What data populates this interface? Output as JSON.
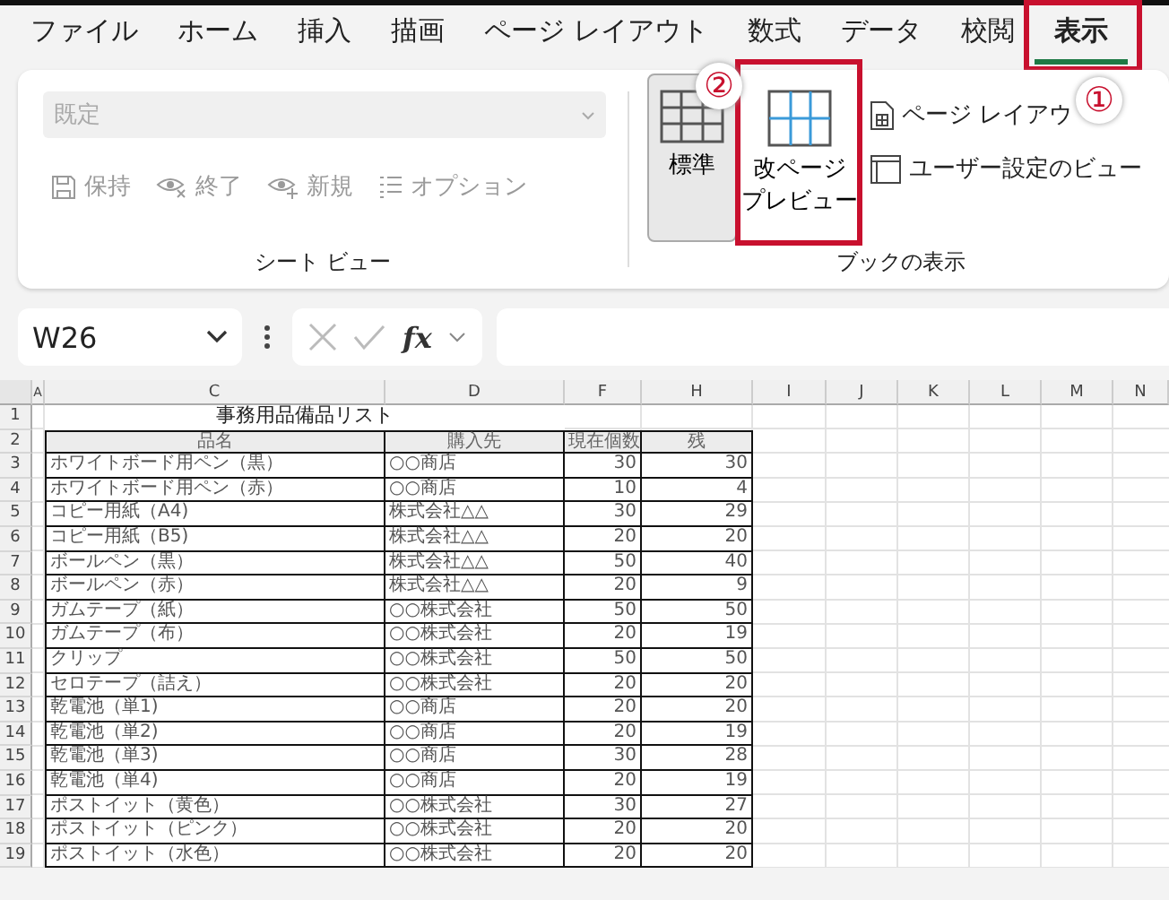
{
  "tabs": [
    {
      "label": "ファイル",
      "selected": false,
      "highlighted": false
    },
    {
      "label": "ホーム",
      "selected": false,
      "highlighted": false
    },
    {
      "label": "挿入",
      "selected": false,
      "highlighted": false
    },
    {
      "label": "描画",
      "selected": false,
      "highlighted": false
    },
    {
      "label": "ページ レイアウト",
      "selected": false,
      "highlighted": false
    },
    {
      "label": "数式",
      "selected": false,
      "highlighted": false
    },
    {
      "label": "データ",
      "selected": false,
      "highlighted": false
    },
    {
      "label": "校閲",
      "selected": false,
      "highlighted": false
    },
    {
      "label": "表示",
      "selected": true,
      "highlighted": true
    }
  ],
  "sheet_view": {
    "dropdown": {
      "value": "既定",
      "disabled": true
    },
    "buttons": [
      {
        "label": "保持",
        "kind": "save",
        "disabled": true
      },
      {
        "label": "終了",
        "kind": "exit",
        "disabled": true
      },
      {
        "label": "新規",
        "kind": "new",
        "disabled": true
      },
      {
        "label": "オプション",
        "kind": "options",
        "disabled": true
      }
    ],
    "group_label": "シート ビュー"
  },
  "workbook_views": {
    "large_buttons": [
      {
        "lines": [
          "標準"
        ],
        "kind": "normal",
        "selected": true,
        "highlighted": false
      },
      {
        "lines": [
          "改ページ",
          "プレビュー"
        ],
        "kind": "pagebreak",
        "selected": false,
        "highlighted": true
      }
    ],
    "small_buttons": [
      {
        "label": "ページ レイアウ",
        "kind": "page"
      },
      {
        "label": "ユーザー設定のビュー",
        "kind": "custom"
      }
    ],
    "group_label": "ブックの表示"
  },
  "annotations": [
    {
      "number": "②",
      "kind": "button"
    },
    {
      "number": "①",
      "kind": "tab"
    }
  ],
  "formula_bar": {
    "name_box": "W26",
    "fx": "fx"
  },
  "sheet": {
    "columns": [
      "A",
      "C",
      "D",
      "F",
      "H",
      "I",
      "J",
      "K",
      "L",
      "M",
      "N"
    ],
    "title_row": {
      "number": "1",
      "title": "事務用品備品リスト"
    },
    "header_row": {
      "number": "2",
      "cells": [
        "",
        "品名",
        "購入先",
        "現在個数",
        "残"
      ]
    },
    "rows": [
      {
        "number": "3",
        "cells": [
          "",
          "ホワイトボード用ペン（黒）",
          "○○商店",
          "30",
          "30"
        ]
      },
      {
        "number": "4",
        "cells": [
          "",
          "ホワイトボード用ペン（赤）",
          "○○商店",
          "10",
          "4"
        ]
      },
      {
        "number": "5",
        "cells": [
          "",
          "コピー用紙（A4)",
          "株式会社△△",
          "30",
          "29"
        ]
      },
      {
        "number": "6",
        "cells": [
          "",
          "コピー用紙（B5)",
          "株式会社△△",
          "20",
          "20"
        ]
      },
      {
        "number": "7",
        "cells": [
          "",
          "ボールペン（黒）",
          "株式会社△△",
          "50",
          "40"
        ]
      },
      {
        "number": "8",
        "cells": [
          "",
          "ボールペン（赤）",
          "株式会社△△",
          "20",
          "9"
        ]
      },
      {
        "number": "9",
        "cells": [
          "",
          "ガムテープ（紙）",
          "○○株式会社",
          "50",
          "50"
        ]
      },
      {
        "number": "10",
        "cells": [
          "",
          "ガムテープ（布）",
          "○○株式会社",
          "20",
          "19"
        ]
      },
      {
        "number": "11",
        "cells": [
          "",
          "クリップ",
          "○○株式会社",
          "50",
          "50"
        ]
      },
      {
        "number": "12",
        "cells": [
          "",
          "セロテープ（詰え）",
          "○○株式会社",
          "20",
          "20"
        ]
      },
      {
        "number": "13",
        "cells": [
          "",
          "乾電池（単1)",
          "○○商店",
          "20",
          "20"
        ]
      },
      {
        "number": "14",
        "cells": [
          "",
          "乾電池（単2)",
          "○○商店",
          "20",
          "19"
        ]
      },
      {
        "number": "15",
        "cells": [
          "",
          "乾電池（単3)",
          "○○商店",
          "30",
          "28"
        ]
      },
      {
        "number": "16",
        "cells": [
          "",
          "乾電池（単4)",
          "○○商店",
          "20",
          "19"
        ]
      },
      {
        "number": "17",
        "cells": [
          "",
          "ポストイット（黄色）",
          "○○株式会社",
          "30",
          "27"
        ]
      },
      {
        "number": "18",
        "cells": [
          "",
          "ポストイット（ピンク）",
          "○○株式会社",
          "20",
          "20"
        ]
      },
      {
        "number": "19",
        "cells": [
          "",
          "ポストイット（水色）",
          "○○株式会社",
          "20",
          "20"
        ]
      }
    ]
  }
}
